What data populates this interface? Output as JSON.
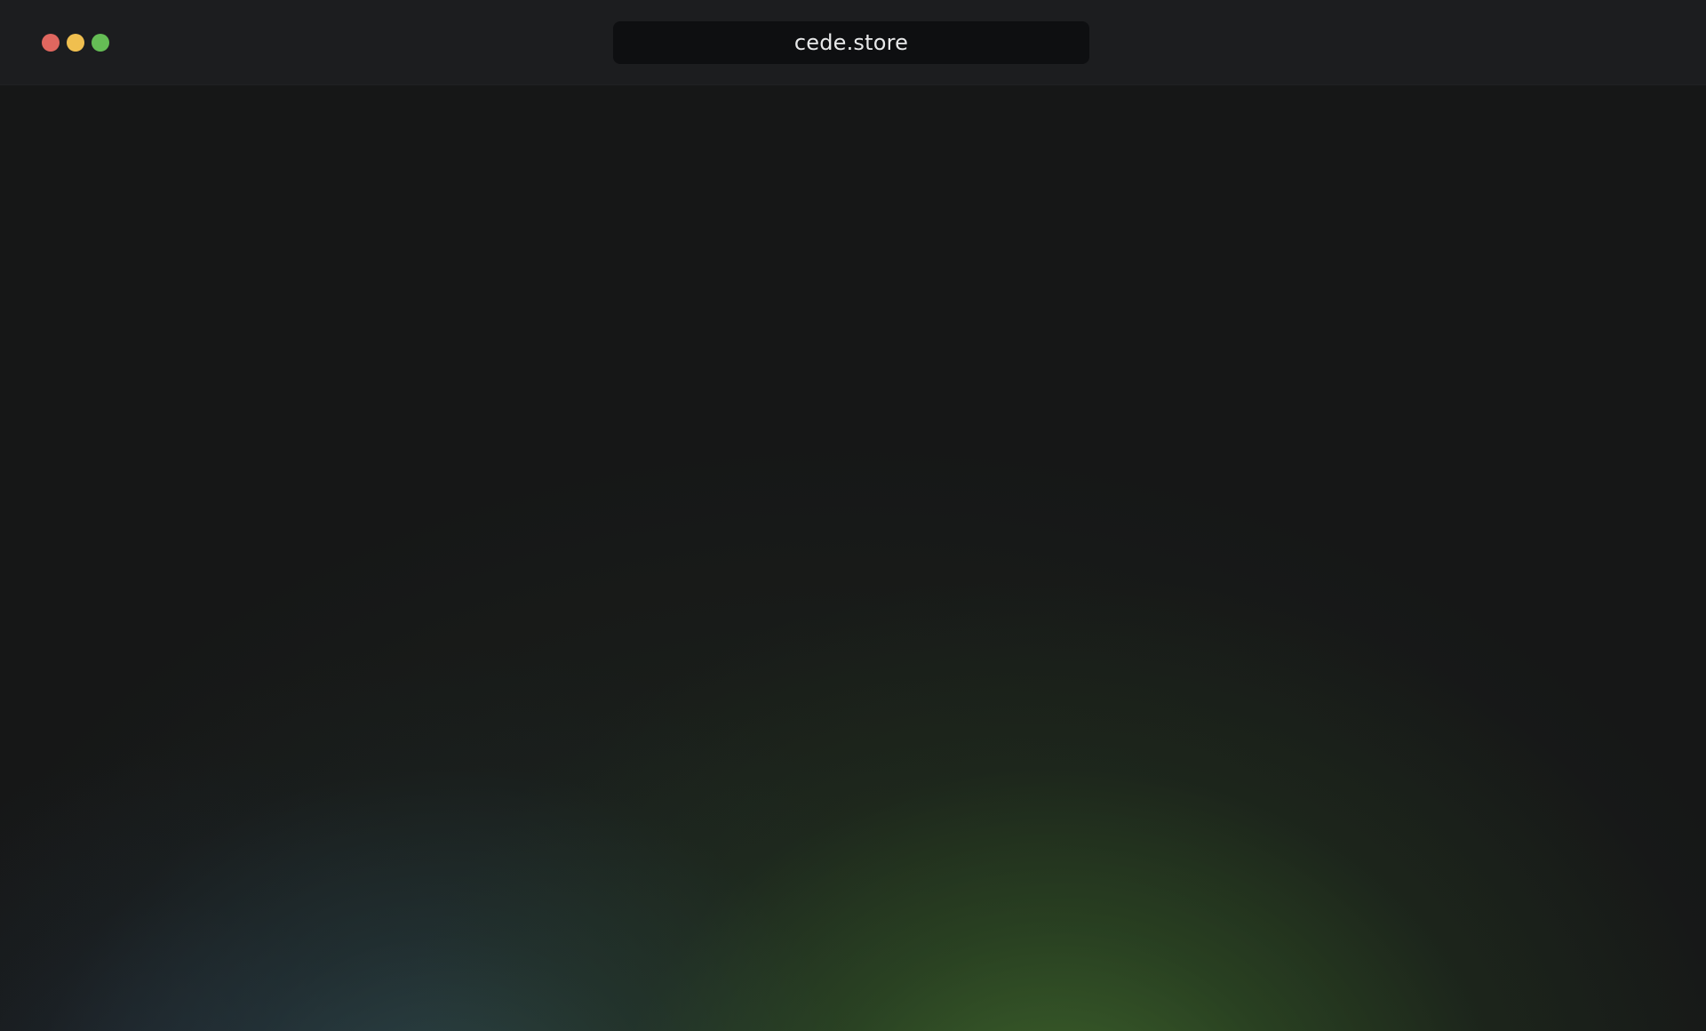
{
  "window": {
    "controls": {
      "close_color": "#e0675f",
      "minimize_color": "#f0bf4f",
      "maximize_color": "#65bd55"
    },
    "address_bar": {
      "url": "cede.store"
    }
  },
  "content": {
    "accent_colors": [
      "#3e6a2e",
      "#2e4a4e",
      "#232a38"
    ]
  }
}
